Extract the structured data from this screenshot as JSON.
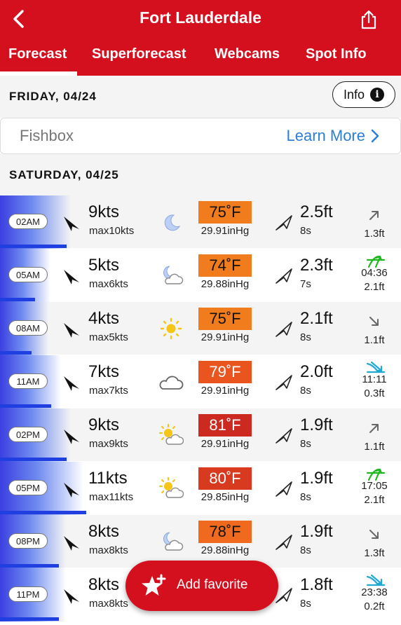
{
  "header": {
    "title": "Fort Lauderdale",
    "back_icon": "chevron-left-icon",
    "share_icon": "share-icon"
  },
  "tabs": [
    {
      "label": "Forecast",
      "active": true
    },
    {
      "label": "Superforecast",
      "active": false
    },
    {
      "label": "Webcams",
      "active": false
    },
    {
      "label": "Spot Info",
      "active": false
    }
  ],
  "day1": {
    "label": "FRIDAY, 04/24",
    "info_label": "Info",
    "info_icon": "info-icon"
  },
  "fishbox": {
    "title": "Fishbox",
    "link": "Learn More",
    "link_icon": "chevron-right-icon"
  },
  "day2": {
    "label": "SATURDAY, 04/25"
  },
  "rows": [
    {
      "time": "02AM",
      "wind": "9kts",
      "max": "max10kts",
      "weather": "moon",
      "temp": "75˚F",
      "pressure": "29.91inHg",
      "swell": "2.5ft",
      "period": "8s",
      "tide_icon": "arrow-up-right",
      "tide_time": "",
      "tide_height": "1.3ft",
      "wind_level": 0.17,
      "temp_color": "#f07c1e"
    },
    {
      "time": "05AM",
      "wind": "5kts",
      "max": "max6kts",
      "weather": "moon-cloud",
      "temp": "74˚F",
      "pressure": "29.88inHg",
      "swell": "2.3ft",
      "period": "7s",
      "tide_icon": "high-tide",
      "tide_time": "04:36",
      "tide_height": "2.1ft",
      "wind_level": 0.09,
      "temp_color": "#f07c1e"
    },
    {
      "time": "08AM",
      "wind": "4kts",
      "max": "max5kts",
      "weather": "sun",
      "temp": "75˚F",
      "pressure": "29.91inHg",
      "swell": "2.1ft",
      "period": "8s",
      "tide_icon": "arrow-down-right",
      "tide_time": "",
      "tide_height": "1.1ft",
      "wind_level": 0.08,
      "temp_color": "#f07c1e"
    },
    {
      "time": "11AM",
      "wind": "7kts",
      "max": "max7kts",
      "weather": "cloud",
      "temp": "79˚F",
      "pressure": "29.91inHg",
      "swell": "2.0ft",
      "period": "8s",
      "tide_icon": "low-tide",
      "tide_time": "11:11",
      "tide_height": "0.3ft",
      "wind_level": 0.13,
      "temp_color": "#e9541f"
    },
    {
      "time": "02PM",
      "wind": "9kts",
      "max": "max9kts",
      "weather": "sun-cloud",
      "temp": "81˚F",
      "pressure": "29.91inHg",
      "swell": "1.9ft",
      "period": "8s",
      "tide_icon": "arrow-up-right",
      "tide_time": "",
      "tide_height": "1.1ft",
      "wind_level": 0.17,
      "temp_color": "#cc2a20"
    },
    {
      "time": "05PM",
      "wind": "11kts",
      "max": "max11kts",
      "weather": "sun-cloud",
      "temp": "80˚F",
      "pressure": "29.85inHg",
      "swell": "1.9ft",
      "period": "8s",
      "tide_icon": "high-tide",
      "tide_time": "17:05",
      "tide_height": "2.1ft",
      "wind_level": 0.22,
      "temp_color": "#d83a20"
    },
    {
      "time": "08PM",
      "wind": "8kts",
      "max": "max8kts",
      "weather": "moon-cloud",
      "temp": "78˚F",
      "pressure": "29.88inHg",
      "swell": "1.9ft",
      "period": "8s",
      "tide_icon": "arrow-down-right",
      "tide_time": "",
      "tide_height": "1.3ft",
      "wind_level": 0.15,
      "temp_color": "#ef6a1f"
    },
    {
      "time": "11PM",
      "wind": "8kts",
      "max": "max8kts",
      "weather": "moon",
      "temp": "",
      "pressure": "",
      "swell": "1.8ft",
      "period": "8s",
      "tide_icon": "low-tide",
      "tide_time": "23:38",
      "tide_height": "0.2ft",
      "wind_level": 0.15,
      "temp_color": ""
    }
  ],
  "fab": {
    "label": "Add favorite",
    "icon": "star-plus-icon"
  },
  "colors": {
    "brand_red": "#d4101f",
    "link_blue": "#2b7fd8",
    "tide_green": "#1fb91f",
    "tide_cyan": "#21a9d6"
  }
}
